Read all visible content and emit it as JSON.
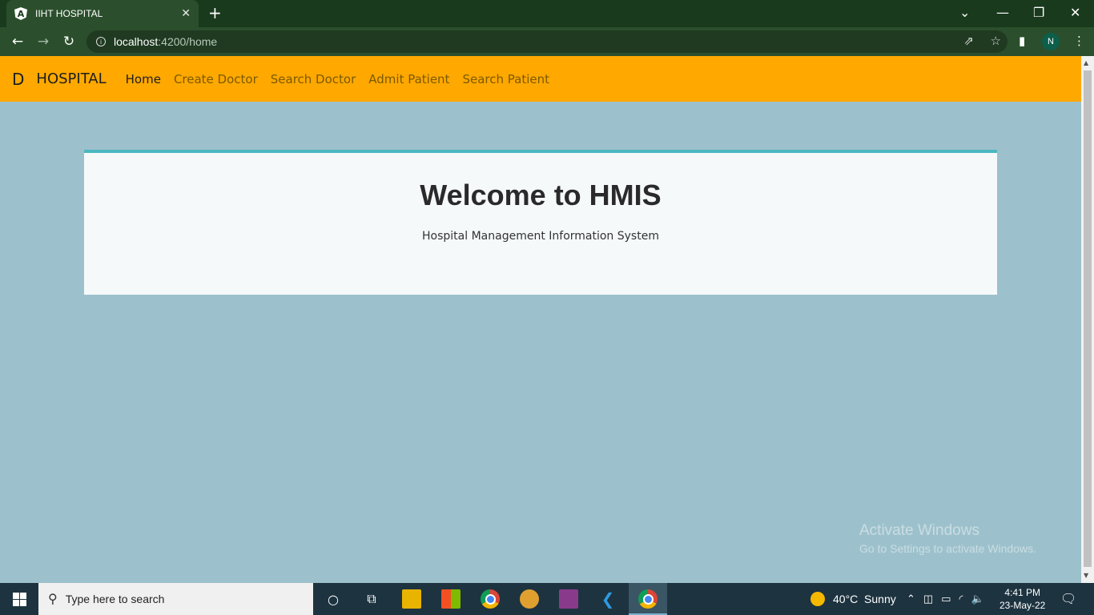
{
  "browser": {
    "tab_title": "IIHT HOSPITAL",
    "tab_logo": "A",
    "url_host": "localhost",
    "url_path": ":4200/home",
    "profile_initial": "N"
  },
  "navbar": {
    "brand_letter": "D",
    "brand_name": "HOSPITAL",
    "links": [
      "Home",
      "Create Doctor",
      "Search Doctor",
      "Admit Patient",
      "Search Patient"
    ],
    "active": "Home"
  },
  "jumbotron": {
    "title": "Welcome to HMIS",
    "subtitle": "Hospital Management Information System"
  },
  "watermark": {
    "line1": "Activate Windows",
    "line2": "Go to Settings to activate Windows."
  },
  "taskbar": {
    "search_placeholder": "Type here to search",
    "weather": "40°C  Sunny",
    "time": "4:41 PM",
    "date": "23-May-22"
  },
  "colors": {
    "navbar": "#ffa800",
    "page_bg": "#9dc1cc",
    "jumbo_border": "#4bb8c0"
  }
}
